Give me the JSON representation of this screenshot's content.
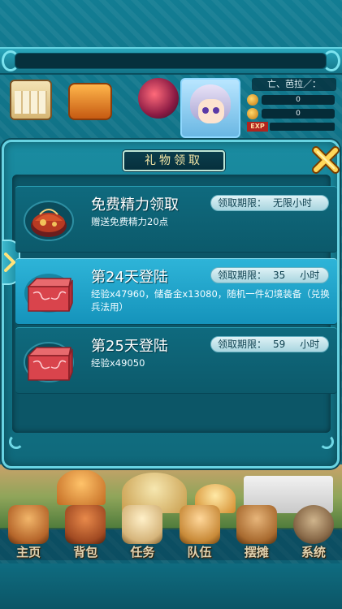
{
  "player": {
    "name": "亡、芭拉／：",
    "gold": "0",
    "silver": "0",
    "exp_tag": "EXP"
  },
  "dialog": {
    "title": "礼物领取"
  },
  "rewards": [
    {
      "title": "免费精力领取",
      "deadline_label": "领取期限：",
      "deadline_value": "无限小时",
      "deadline_unit": "",
      "description": "赠送免费精力20点",
      "icon": "energy-pouch-icon",
      "selected": false
    },
    {
      "title": "第24天登陆",
      "deadline_label": "领取期限：",
      "deadline_value": "35",
      "deadline_unit": "小时",
      "description": "经验x47960，储备金x13080，随机一件幻境装备（兑换兵法用）",
      "icon": "red-chest-icon",
      "selected": true
    },
    {
      "title": "第25天登陆",
      "deadline_label": "领取期限：",
      "deadline_value": "59",
      "deadline_unit": "小时",
      "description": "经验x49050",
      "icon": "red-chest-icon",
      "selected": false
    }
  ],
  "nav": [
    {
      "label": "主页",
      "icon": "home-pavilion-icon",
      "color": "#b5652a"
    },
    {
      "label": "背包",
      "icon": "backpack-icon",
      "color": "#a14a22"
    },
    {
      "label": "任务",
      "icon": "scroll-task-icon",
      "color": "#d5b47a"
    },
    {
      "label": "队伍",
      "icon": "team-icon",
      "color": "#c88a38"
    },
    {
      "label": "摆摊",
      "icon": "stall-icon",
      "color": "#a86a2f"
    },
    {
      "label": "系统",
      "icon": "gear-icon",
      "color": "#8a6b4a"
    }
  ],
  "colors": {
    "accent": "#68d3e2",
    "selected_row": "#1fa3c8",
    "title_text": "#f4e6a6"
  }
}
